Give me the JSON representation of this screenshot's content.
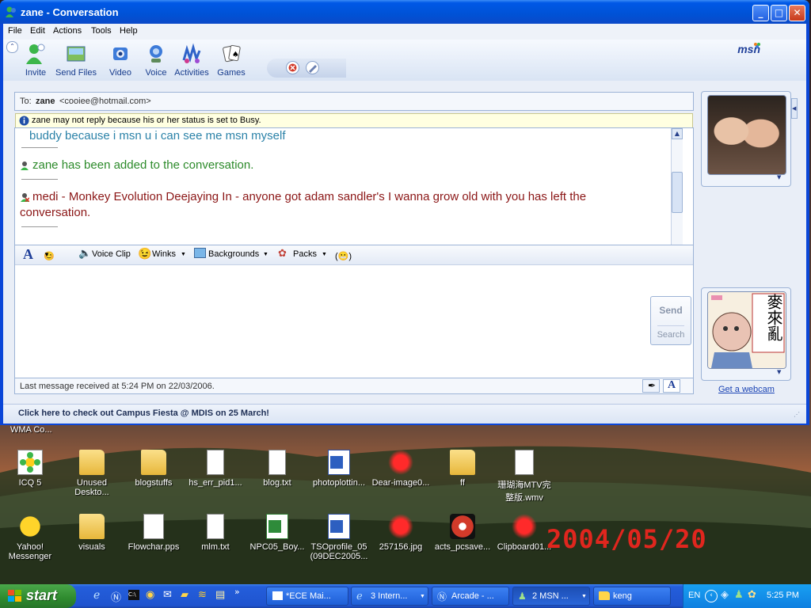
{
  "window": {
    "title": "zane - Conversation"
  },
  "menu": [
    "File",
    "Edit",
    "Actions",
    "Tools",
    "Help"
  ],
  "toolbar": {
    "items": [
      "Invite",
      "Send Files",
      "Video",
      "Voice",
      "Activities",
      "Games"
    ],
    "logo": "msn"
  },
  "to": {
    "prefix": "To:",
    "name": "zane",
    "email": "<cooiee@hotmail.com>"
  },
  "info": "zane may not reply because his or her status is set to Busy.",
  "conversation": {
    "line1": "buddy because i msn u i can see me msn myself",
    "line2": "zane has been added to the conversation.",
    "line3a": "medi - Monkey Evolution Deejaying In -  anyone got adam sandler's I wanna grow old with you has left the",
    "line3b": "conversation."
  },
  "format": {
    "voice_clip": "Voice Clip",
    "winks": "Winks",
    "backgrounds": "Backgrounds",
    "packs": "Packs"
  },
  "send": {
    "send_label": "Send",
    "search_label": "Search"
  },
  "status_text": "Last message received at 5:24 PM on 22/03/2006.",
  "ad_text": "Click here to check out Campus Fiesta @ MDIS on 25 March!",
  "webcam_link": "Get a webcam",
  "sticker_text": "麥來亂",
  "desktop": {
    "wma": "WMA Co...",
    "row1": [
      "ICQ 5",
      "Unused Deskto...",
      "blogstuffs",
      "hs_err_pid1...",
      "blog.txt",
      "photoplottin...",
      "Dear-image0...",
      "ff",
      "珊瑚海MTV完整版.wmv"
    ],
    "row2": [
      "Yahoo! Messenger",
      "visuals",
      "Flowchar.pps",
      "mlm.txt",
      "NPC05_Boy...",
      "TSOprofile_05 (09DEC2005...",
      "257156.jpg",
      "acts_pcsave...",
      "Clipboard01..."
    ],
    "date_stamp": "2004/05/20"
  },
  "taskbar": {
    "start": "start",
    "tasks": [
      "*ECE Mai...",
      "3 Intern...",
      "Arcade - ...",
      "2 MSN ...",
      "keng"
    ],
    "lang": "EN",
    "clock": "5:25 PM"
  }
}
